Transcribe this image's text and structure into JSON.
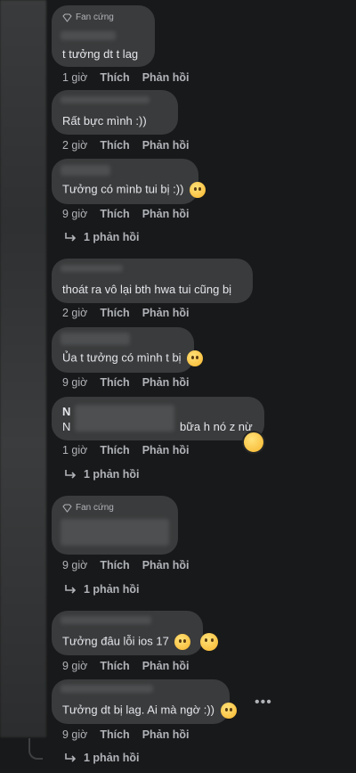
{
  "labels": {
    "like": "Thích",
    "reply": "Phản hồi",
    "fan_badge": "Fan cứng"
  },
  "comments": [
    {
      "text": "t tưởng dt t lag",
      "time": "1 giờ"
    },
    {
      "text": "Rất bực mình :))",
      "time": "2 giờ"
    },
    {
      "text": "Tưởng có mìnb tui bị :))",
      "time": "9 giờ",
      "replies": "1 phản hồi"
    },
    {
      "text": "thoát ra vô lại bth hwa tui cũng bị",
      "time": "2 giờ"
    },
    {
      "text": "Ủa t tưởng có mình t bị",
      "time": "9 giờ"
    },
    {
      "line1": "N",
      "line2_a": "N",
      "line2_b": "bữa h nó z nừ",
      "time": "1 giờ",
      "replies": "1 phản hồi"
    },
    {
      "text": "",
      "time": "9 giờ",
      "replies": "1 phản hồi"
    },
    {
      "text": "Tưởng đâu lỗi ios 17",
      "time": "9 giờ"
    },
    {
      "text": "Tưởng dt bị lag. Ai mà ngờ :))",
      "time": "9 giờ",
      "replies": "1 phản hồi"
    }
  ],
  "icons": {
    "reply_arrow": "reply-arrow-icon",
    "badge": "diamond-icon",
    "more": "more-dots-icon"
  },
  "colors": {
    "background": "#18191a",
    "bubble": "#3a3b3c",
    "secondary_text": "#b0b3b8",
    "primary_text": "#e4e6eb"
  }
}
